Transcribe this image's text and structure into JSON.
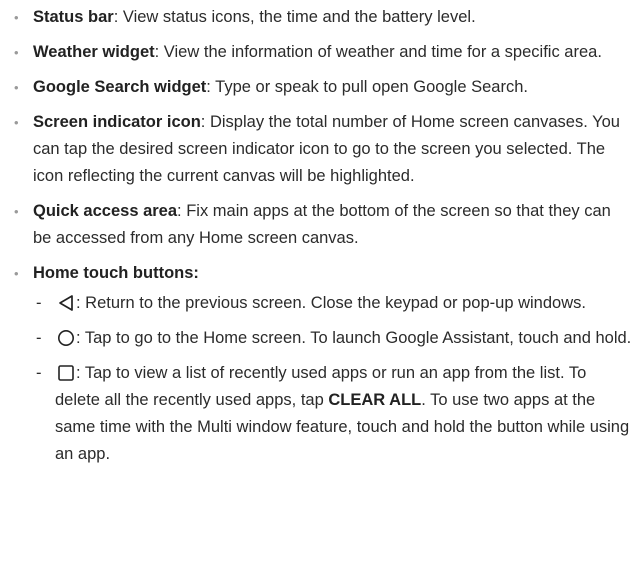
{
  "items": [
    {
      "term": "Status bar",
      "desc": ": View status icons, the time and the battery level."
    },
    {
      "term": "Weather widget",
      "desc": ": View the information of weather and time for a specific area."
    },
    {
      "term": "Google Search widget",
      "desc": ": Type or speak to pull open Google Search."
    },
    {
      "term": "Screen indicator icon",
      "desc": ": Display the total number of Home screen canvases. You can tap the desired screen indicator icon to go to the screen you selected. The icon reflecting the current canvas will be highlighted."
    },
    {
      "term": "Quick access area",
      "desc": ": Fix main apps at the bottom of the screen so that they can be accessed from any Home screen canvas."
    }
  ],
  "home_buttons": {
    "heading": "Home touch buttons:",
    "dash": "-",
    "back": {
      "icon": "back-triangle-icon",
      "text": ": Return to the previous screen. Close the keypad or pop-up windows."
    },
    "home": {
      "icon": "home-circle-icon",
      "text": ": Tap to go to the Home screen. To launch Google Assistant, touch and hold."
    },
    "recent": {
      "icon": "recent-square-icon",
      "text_before": ": Tap to view a list of recently used apps or run an app from the list. To delete all the recently used apps, tap ",
      "strong": "CLEAR ALL",
      "text_after": ". To use two apps at the same time with the Multi window feature, touch and hold the button while using an app."
    }
  }
}
